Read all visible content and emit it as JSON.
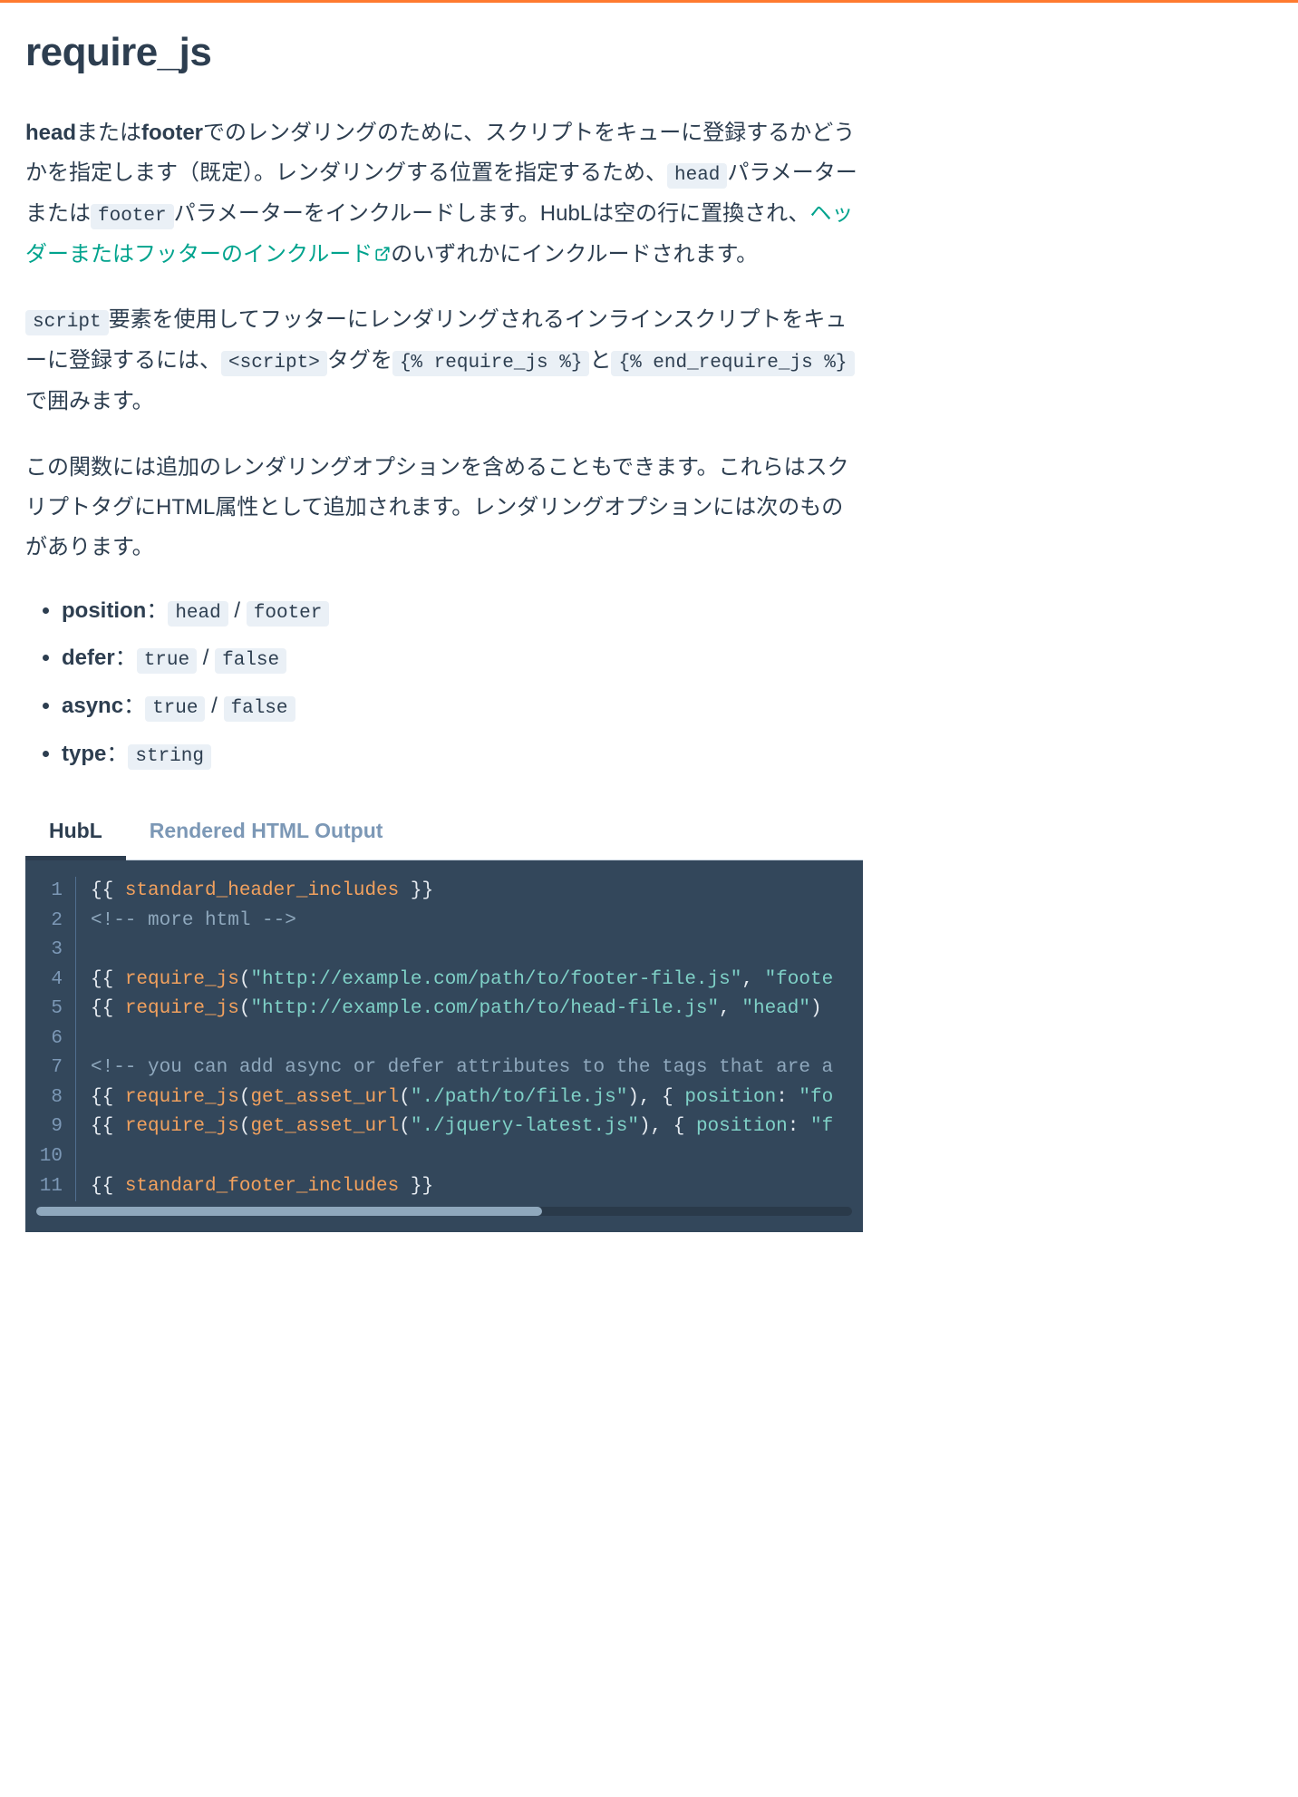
{
  "title": "require_js",
  "para1": {
    "b1": "head",
    "t1": "または",
    "b2": "footer",
    "t2": "でのレンダリングのために、スクリプトをキューに登録するかどうかを指定します（既定）。レンダリングする位置を指定するため、",
    "c1": "head",
    "t3": "パラメーターまたは",
    "c2": "footer",
    "t4": "パラメーターをインクルードします。HubLは空の行に置換され、",
    "link": "ヘッダーまたはフッターのインクルード",
    "t5": "のいずれかにインクルードされます。"
  },
  "para2": {
    "c1": "script",
    "t1": "要素を使用してフッターにレンダリングされるインラインスクリプトをキューに登録するには、",
    "c2": "<script>",
    "t2": "タグを",
    "c3": "{% require_js %}",
    "t3": "と",
    "c4": "{% end_require_js %}",
    "t4": "で囲みます。"
  },
  "para3": "この関数には追加のレンダリングオプションを含めることもできます。これらはスクリプトタグにHTML属性として追加されます。レンダリングオプションには次のものがあります。",
  "opts": {
    "position": {
      "label": "position",
      "sep": "：",
      "v1": "head",
      "mid": " / ",
      "v2": "footer"
    },
    "defer": {
      "label": "defer",
      "sep": "：",
      "v1": "true",
      "mid": " / ",
      "v2": "false"
    },
    "async": {
      "label": "async",
      "sep": "：",
      "v1": "true",
      "mid": " / ",
      "v2": "false"
    },
    "type": {
      "label": "type",
      "sep": "：",
      "v1": "string"
    }
  },
  "tabs": {
    "t1": "HubL",
    "t2": "Rendered HTML Output"
  },
  "code": {
    "l1": {
      "open": "{{ ",
      "fn": "standard_header_includes",
      "close": " }}"
    },
    "l2": {
      "cmt": "<!-- more html -->"
    },
    "l4": {
      "open": "{{ ",
      "fn": "require_js",
      "p1": "(",
      "s1": "\"http://example.com/path/to/footer-file.js\"",
      "c": ", ",
      "s2": "\"foote"
    },
    "l5": {
      "open": "{{ ",
      "fn": "require_js",
      "p1": "(",
      "s1": "\"http://example.com/path/to/head-file.js\"",
      "c": ", ",
      "s2": "\"head\"",
      "p2": ")"
    },
    "l7": {
      "cmt": "<!-- you can add async or defer attributes to the tags that are a"
    },
    "l8": {
      "open": "{{ ",
      "fn": "require_js",
      "p1": "(",
      "fn2": "get_asset_url",
      "p2": "(",
      "s1": "\"./path/to/file.js\"",
      "p3": "), { ",
      "key": "position",
      "kc": ": ",
      "s2": "\"fo"
    },
    "l9": {
      "open": "{{ ",
      "fn": "require_js",
      "p1": "(",
      "fn2": "get_asset_url",
      "p2": "(",
      "s1": "\"./jquery-latest.js\"",
      "p3": "), { ",
      "key": "position",
      "kc": ": ",
      "s2": "\"f"
    },
    "l11": {
      "open": "{{ ",
      "fn": "standard_footer_includes",
      "close": " }}"
    }
  }
}
